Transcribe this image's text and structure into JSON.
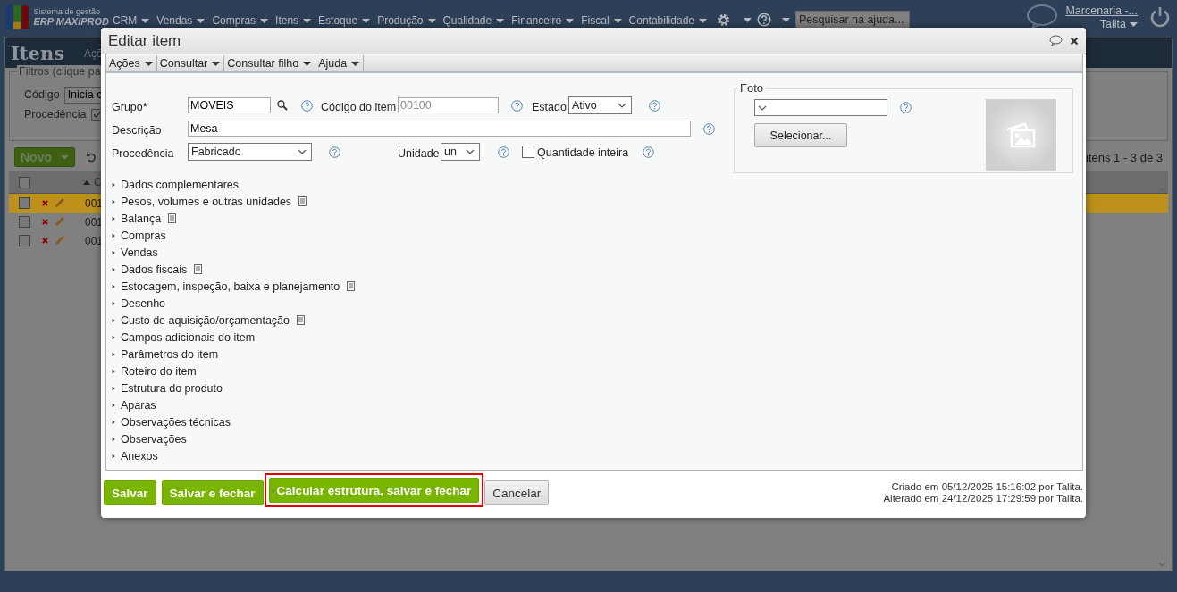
{
  "header": {
    "logo_line1": "Sistema de gestão",
    "logo_line2": "ERP MAXIPROD",
    "menu": [
      "CRM",
      "Vendas",
      "Compras",
      "Itens",
      "Estoque",
      "Produção",
      "Qualidade",
      "Financeiro",
      "Fiscal",
      "Contabilidade"
    ],
    "search": {
      "placeholder": "Pesquisar na ajuda..."
    },
    "company": "Marcenaria -...",
    "user": "Talita"
  },
  "page": {
    "title": "Itens",
    "actions": "Açõ",
    "filters": {
      "legend": "Filtros (clique pa",
      "code_label": "Código",
      "code_value": "Inicia c",
      "origin_label": "Procedência",
      "origin_checked": true
    },
    "new_button": "Novo",
    "pager": "itens 1 - 3 de 3",
    "sort_column": "C",
    "all_checked": false,
    "rows": [
      {
        "code": "001",
        "selected": true,
        "checked": false
      },
      {
        "code": "001",
        "selected": false,
        "checked": false
      },
      {
        "code": "001",
        "selected": false,
        "checked": false
      }
    ]
  },
  "dialog": {
    "title": "Editar item",
    "menus": [
      "Ações",
      "Consultar",
      "Consultar filho",
      "Ajuda"
    ],
    "group": {
      "label": "Grupo*",
      "value": "MOVEIS"
    },
    "code": {
      "label": "Código do item",
      "value": "00100",
      "disabled": true
    },
    "status": {
      "label": "Estado",
      "value": "Ativo"
    },
    "description": {
      "label": "Descrição",
      "value": "Mesa"
    },
    "origin": {
      "label": "Procedência",
      "value": "Fabricado"
    },
    "unit": {
      "label": "Unidade",
      "value": "un"
    },
    "integer_quantity": {
      "label": "Quantidade inteira",
      "checked": false
    },
    "photo": {
      "legend": "Foto",
      "button": "Selecionar..."
    },
    "sections": [
      {
        "label": "Dados complementares",
        "expanded": false,
        "note": false
      },
      {
        "label": "Pesos, volumes e outras unidades",
        "expanded": false,
        "note": true
      },
      {
        "label": "Balança",
        "expanded": false,
        "note": true
      },
      {
        "label": "Compras",
        "expanded": false,
        "note": false
      },
      {
        "label": "Vendas",
        "expanded": false,
        "note": false
      },
      {
        "label": "Dados fiscais",
        "expanded": false,
        "note": true
      },
      {
        "label": "Estocagem, inspeção, baixa e planejamento",
        "expanded": false,
        "note": true
      },
      {
        "label": "Desenho",
        "expanded": false,
        "note": false
      },
      {
        "label": "Custo de aquisição/orçamentação",
        "expanded": false,
        "note": true
      },
      {
        "label": "Campos adicionais do item",
        "expanded": false,
        "note": false
      },
      {
        "label": "Parâmetros do item",
        "expanded": false,
        "note": false
      },
      {
        "label": "Roteiro do item",
        "expanded": false,
        "note": false
      },
      {
        "label": "Estrutura do produto",
        "expanded": false,
        "note": false
      },
      {
        "label": "Aparas",
        "expanded": false,
        "note": false
      },
      {
        "label": "Observações técnicas",
        "expanded": false,
        "note": false
      },
      {
        "label": "Observações",
        "expanded": false,
        "note": false
      },
      {
        "label": "Anexos",
        "expanded": false,
        "note": false
      }
    ],
    "buttons": [
      {
        "label": "Salvar",
        "kind": "primary",
        "highlighted": false
      },
      {
        "label": "Salvar e fechar",
        "kind": "primary",
        "highlighted": false
      },
      {
        "label": "Calcular estrutura, salvar e fechar",
        "kind": "primary",
        "highlighted": true
      },
      {
        "label": "Cancelar",
        "kind": "secondary",
        "highlighted": false
      }
    ],
    "created": "Criado em 05/12/2025 15:16:02 por Talita.",
    "modified": "Alterado em 24/12/2025 17:29:59 por Talita."
  }
}
